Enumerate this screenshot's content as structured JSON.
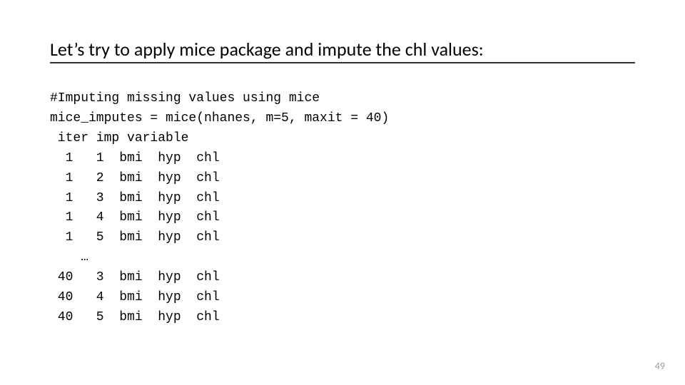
{
  "title": "Let’s try to apply mice package and impute the chl values:",
  "code": {
    "comment": "#Imputing missing values using mice",
    "call": "mice_imputes = mice(nhanes, m=5, maxit = 40)",
    "header": " iter imp variable",
    "rows": [
      {
        "iter": 1,
        "imp": 1,
        "vars": [
          "bmi",
          "hyp",
          "chl"
        ]
      },
      {
        "iter": 1,
        "imp": 2,
        "vars": [
          "bmi",
          "hyp",
          "chl"
        ]
      },
      {
        "iter": 1,
        "imp": 3,
        "vars": [
          "bmi",
          "hyp",
          "chl"
        ]
      },
      {
        "iter": 1,
        "imp": 4,
        "vars": [
          "bmi",
          "hyp",
          "chl"
        ]
      },
      {
        "iter": 1,
        "imp": 5,
        "vars": [
          "bmi",
          "hyp",
          "chl"
        ]
      }
    ],
    "ellipsis": "    …",
    "rows_tail": [
      {
        "iter": 40,
        "imp": 3,
        "vars": [
          "bmi",
          "hyp",
          "chl"
        ]
      },
      {
        "iter": 40,
        "imp": 4,
        "vars": [
          "bmi",
          "hyp",
          "chl"
        ]
      },
      {
        "iter": 40,
        "imp": 5,
        "vars": [
          "bmi",
          "hyp",
          "chl"
        ]
      }
    ]
  },
  "page_number": "49"
}
